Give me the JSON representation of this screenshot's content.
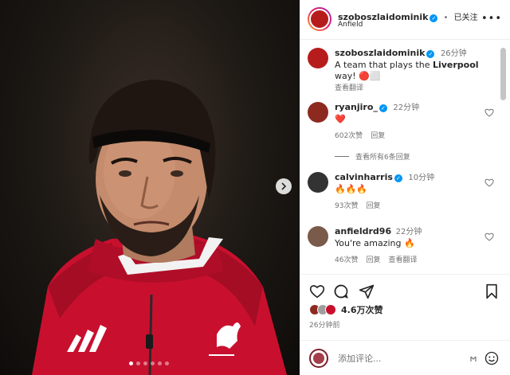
{
  "post": {
    "account": {
      "username": "szoboszlaidominik",
      "follow_status": "已关注",
      "location": "Anfield"
    },
    "caption": {
      "username": "szoboszlaidominik",
      "time": "26分钟",
      "text_before": "A team that plays the ",
      "text_bold": "Liverpool",
      "text_after": " way! 🔴⬜",
      "translate": "查看翻译"
    },
    "comments": [
      {
        "username": "ryanjiro_",
        "verified": true,
        "time": "22分钟",
        "text": "❤️",
        "likes": "602次赞",
        "reply": "回复",
        "extra": ""
      },
      {
        "view_replies": "查看所有6条回复"
      },
      {
        "username": "calvinharris",
        "verified": true,
        "time": "10分钟",
        "text": "🔥🔥🔥",
        "likes": "93次赞",
        "reply": "回复",
        "extra": ""
      },
      {
        "username": "anfieldrd96",
        "verified": false,
        "time": "22分钟",
        "text": "You're amazing 🔥",
        "likes": "46次赞",
        "reply": "回复",
        "extra": "查看翻译"
      }
    ],
    "likes": "4.6万次赞",
    "posted": "26分钟前",
    "comment_placeholder": "添加评论...",
    "carousel": {
      "count": 6,
      "active_index": 0
    }
  },
  "colors": {
    "accent": "#0095f6",
    "kit_red": "#c8102e",
    "text": "#262626",
    "muted": "#737373"
  }
}
